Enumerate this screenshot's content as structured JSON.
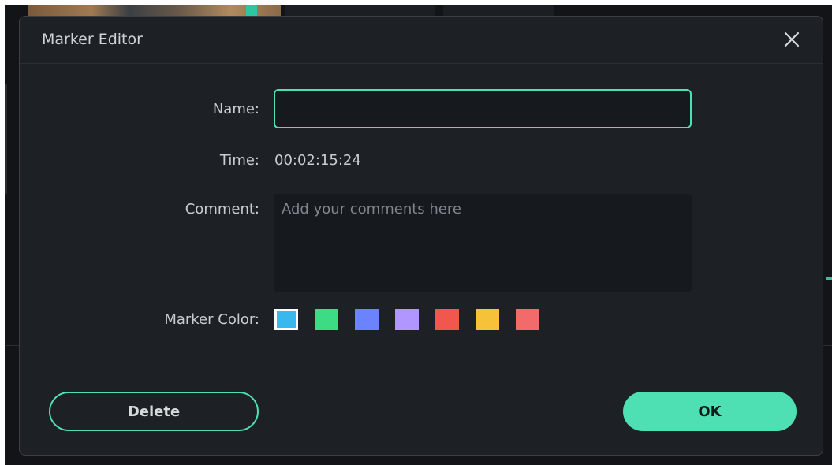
{
  "dialog": {
    "title": "Marker Editor",
    "close_icon": "close-icon"
  },
  "fields": {
    "name_label": "Name:",
    "name_value": "",
    "time_label": "Time:",
    "time_value": "00:02:15:24",
    "comment_label": "Comment:",
    "comment_placeholder": "Add your comments here",
    "color_label": "Marker Color:"
  },
  "marker_colors": [
    {
      "name": "blue",
      "hex": "#39b8f0",
      "selected": true
    },
    {
      "name": "green",
      "hex": "#3ddc84"
    },
    {
      "name": "periwinkle",
      "hex": "#6b83ff"
    },
    {
      "name": "lavender",
      "hex": "#b196ff"
    },
    {
      "name": "red",
      "hex": "#f2574e"
    },
    {
      "name": "yellow",
      "hex": "#f5c23a"
    },
    {
      "name": "salmon",
      "hex": "#f26a6a"
    }
  ],
  "buttons": {
    "delete_label": "Delete",
    "ok_label": "OK"
  },
  "colors": {
    "accent": "#4ee0b3",
    "dialog_bg": "#1d2024",
    "input_bg": "#161a1e"
  }
}
